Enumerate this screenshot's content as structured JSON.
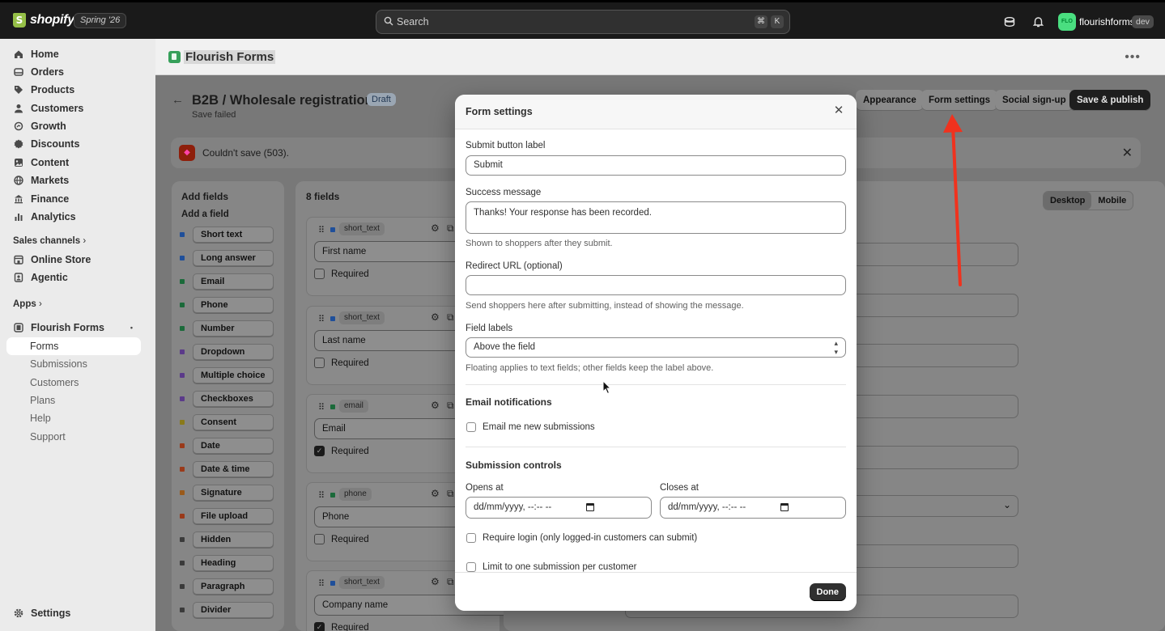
{
  "topbar": {
    "logo_text": "shopify",
    "logo_mark": "S",
    "edition_badge": "Spring '26",
    "search_placeholder": "Search",
    "shortcut_cmd": "⌘",
    "shortcut_key": "K",
    "store_initials": "FLO",
    "store_name": "flourishforms",
    "store_tag": "dev"
  },
  "sidebar": {
    "items": [
      {
        "label": "Home",
        "icon": "home-icon"
      },
      {
        "label": "Orders",
        "icon": "orders-icon"
      },
      {
        "label": "Products",
        "icon": "tag-icon"
      },
      {
        "label": "Customers",
        "icon": "person-icon"
      },
      {
        "label": "Growth",
        "icon": "growth-icon"
      },
      {
        "label": "Discounts",
        "icon": "discount-icon"
      },
      {
        "label": "Content",
        "icon": "content-icon"
      },
      {
        "label": "Markets",
        "icon": "globe-icon"
      },
      {
        "label": "Finance",
        "icon": "bank-icon"
      },
      {
        "label": "Analytics",
        "icon": "chart-icon"
      }
    ],
    "sales_channels_label": "Sales channels",
    "channels": [
      {
        "label": "Online Store",
        "icon": "store-icon"
      },
      {
        "label": "Agentic",
        "icon": "agentic-icon"
      }
    ],
    "apps_label": "Apps",
    "app_name": "Flourish Forms",
    "app_subitems": [
      "Forms",
      "Submissions",
      "Customers",
      "Plans",
      "Help",
      "Support"
    ],
    "settings_label": "Settings"
  },
  "appbar": {
    "title": "Flourish Forms",
    "more_glyph": "•••"
  },
  "page": {
    "back_glyph": "←",
    "title": "B2B / Wholesale registration",
    "status": "Draft",
    "save_status": "Save failed",
    "header_buttons": [
      "Appearance",
      "Form settings",
      "Social sign-up",
      "Save & publish"
    ],
    "error_banner": "Couldn't save (503).",
    "add_fields_title": "Add fields",
    "add_field_subtitle": "Add a field",
    "field_types": [
      {
        "label": "Short text",
        "color": "#1f4f9a"
      },
      {
        "label": "Long answer",
        "color": "#1f4f9a"
      },
      {
        "label": "Email",
        "color": "#1b6a3a"
      },
      {
        "label": "Phone",
        "color": "#1b6a3a"
      },
      {
        "label": "Number",
        "color": "#1b6a3a"
      },
      {
        "label": "Dropdown",
        "color": "#5b3a8a"
      },
      {
        "label": "Multiple choice",
        "color": "#5b3a8a"
      },
      {
        "label": "Checkboxes",
        "color": "#5b3a8a"
      },
      {
        "label": "Consent",
        "color": "#8a7a1a"
      },
      {
        "label": "Date",
        "color": "#9a3a1a"
      },
      {
        "label": "Date & time",
        "color": "#9a3a1a"
      },
      {
        "label": "Signature",
        "color": "#9a5a1a"
      },
      {
        "label": "File upload",
        "color": "#9a3a1a"
      },
      {
        "label": "Hidden",
        "color": "#3a3a3a"
      },
      {
        "label": "Heading",
        "color": "#3a3a3a"
      },
      {
        "label": "Paragraph",
        "color": "#3a3a3a"
      },
      {
        "label": "Divider",
        "color": "#3a3a3a"
      }
    ],
    "fields_count": "8 fields",
    "fields": [
      {
        "type": "short_text",
        "label": "First name",
        "required_label": "Required",
        "required": false,
        "color": "#1f4f9a"
      },
      {
        "type": "short_text",
        "label": "Last name",
        "required_label": "Required",
        "required": false,
        "color": "#1f4f9a"
      },
      {
        "type": "email",
        "label": "Email",
        "required_label": "Required",
        "required": true,
        "color": "#1b6a3a"
      },
      {
        "type": "phone",
        "label": "Phone",
        "required_label": "Required",
        "required": false,
        "color": "#1b6a3a"
      },
      {
        "type": "short_text",
        "label": "Company name",
        "required_label": "Required",
        "required": true,
        "color": "#1f4f9a"
      }
    ],
    "preview_toggle": [
      "Desktop",
      "Mobile"
    ]
  },
  "modal": {
    "title": "Form settings",
    "close_glyph": "✕",
    "submit_label_label": "Submit button label",
    "submit_label_value": "Submit",
    "success_message_label": "Success message",
    "success_message_value": "Thanks! Your response has been recorded.",
    "success_message_hint": "Shown to shoppers after they submit.",
    "redirect_label": "Redirect URL (optional)",
    "redirect_value": "",
    "redirect_hint": "Send shoppers here after submitting, instead of showing the message.",
    "field_labels_label": "Field labels",
    "field_labels_value": "Above the field",
    "field_labels_hint": "Floating applies to text fields; other fields keep the label above.",
    "email_section": "Email notifications",
    "email_checkbox": "Email me new submissions",
    "controls_section": "Submission controls",
    "opens_label": "Opens at",
    "opens_value": "dd/mm/yyyy, --:-- --",
    "closes_label": "Closes at",
    "closes_value": "dd/mm/yyyy, --:-- --",
    "require_login": "Require login (only logged-in customers can submit)",
    "limit_one": "Limit to one submission per customer",
    "done_label": "Done"
  },
  "colors": {
    "annotation_arrow": "#f0321e",
    "app_brand": "#36a05a"
  }
}
